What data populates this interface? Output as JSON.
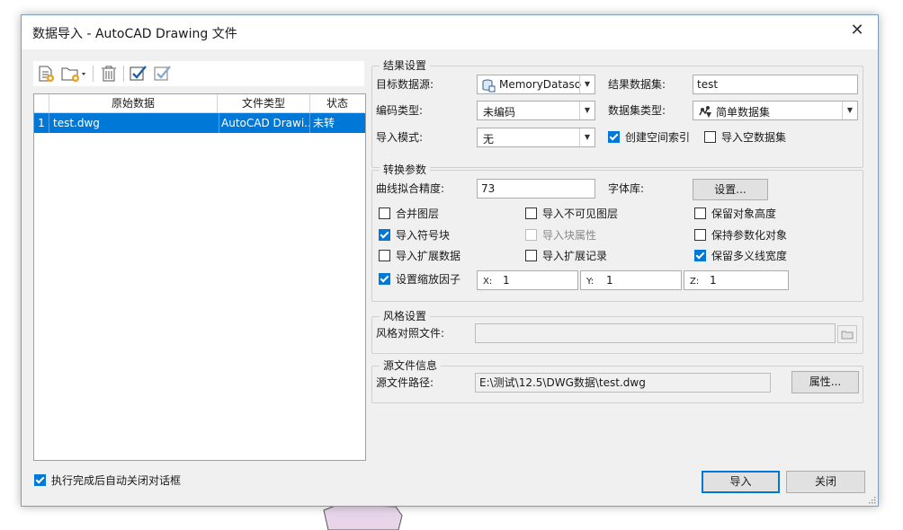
{
  "window": {
    "title": "数据导入 - AutoCAD Drawing 文件",
    "close_glyph": "✕"
  },
  "toolbar": {
    "icons": [
      "add-file-icon",
      "add-folder-dropdown-icon",
      "delete-icon",
      "select-all-icon",
      "invert-select-icon"
    ]
  },
  "grid": {
    "columns": [
      "原始数据",
      "文件类型",
      "状态"
    ],
    "rows": [
      {
        "index": "1",
        "file": "test.dwg",
        "type": "AutoCAD Drawi...",
        "status": "未转"
      }
    ]
  },
  "result_settings": {
    "group_title": "结果设置",
    "target_datasource_label": "目标数据源:",
    "target_datasource_value": "MemoryDatasour",
    "result_dataset_label": "结果数据集:",
    "result_dataset_value": "test",
    "encoding_label": "编码类型:",
    "encoding_value": "未编码",
    "dataset_type_label": "数据集类型:",
    "dataset_type_value": "简单数据集",
    "import_mode_label": "导入模式:",
    "import_mode_value": "无",
    "create_spatial_index": "创建空间索引",
    "import_empty_dataset": "导入空数据集"
  },
  "conversion_params": {
    "group_title": "转换参数",
    "curve_precision_label": "曲线拟合精度:",
    "curve_precision_value": "73",
    "font_lib_label": "字体库:",
    "settings_button": "设置...",
    "merge_layers": "合并图层",
    "import_invisible_layers": "导入不可见图层",
    "keep_object_height": "保留对象高度",
    "import_symbol_blocks": "导入符号块",
    "import_block_attributes": "导入块属性",
    "keep_parametric_objects": "保持参数化对象",
    "import_extended_data": "导入扩展数据",
    "import_extended_records": "导入扩展记录",
    "keep_polyline_width": "保留多义线宽度",
    "set_scale_factor": "设置缩放因子",
    "x_label": "X:",
    "x_value": "1",
    "y_label": "Y:",
    "y_value": "1",
    "z_label": "Z:",
    "z_value": "1"
  },
  "style_settings": {
    "group_title": "风格设置",
    "style_file_label": "风格对照文件:",
    "style_file_value": ""
  },
  "source_info": {
    "group_title": "源文件信息",
    "path_label": "源文件路径:",
    "path_value": "E:\\测试\\12.5\\DWG数据\\test.dwg",
    "properties_button": "属性..."
  },
  "footer": {
    "auto_close_label": "执行完成后自动关闭对话框",
    "import_button": "导入",
    "close_button": "关闭"
  },
  "checkbox_states": {
    "create_spatial_index": true,
    "import_empty_dataset": false,
    "merge_layers": false,
    "import_invisible_layers": false,
    "keep_object_height": false,
    "import_symbol_blocks": true,
    "import_block_attributes": false,
    "keep_parametric_objects": false,
    "import_extended_data": false,
    "import_extended_records": false,
    "keep_polyline_width": true,
    "set_scale_factor": true,
    "auto_close": true
  },
  "colors": {
    "accent": "#0078d7",
    "dialog_bg": "#f0f0f0"
  }
}
